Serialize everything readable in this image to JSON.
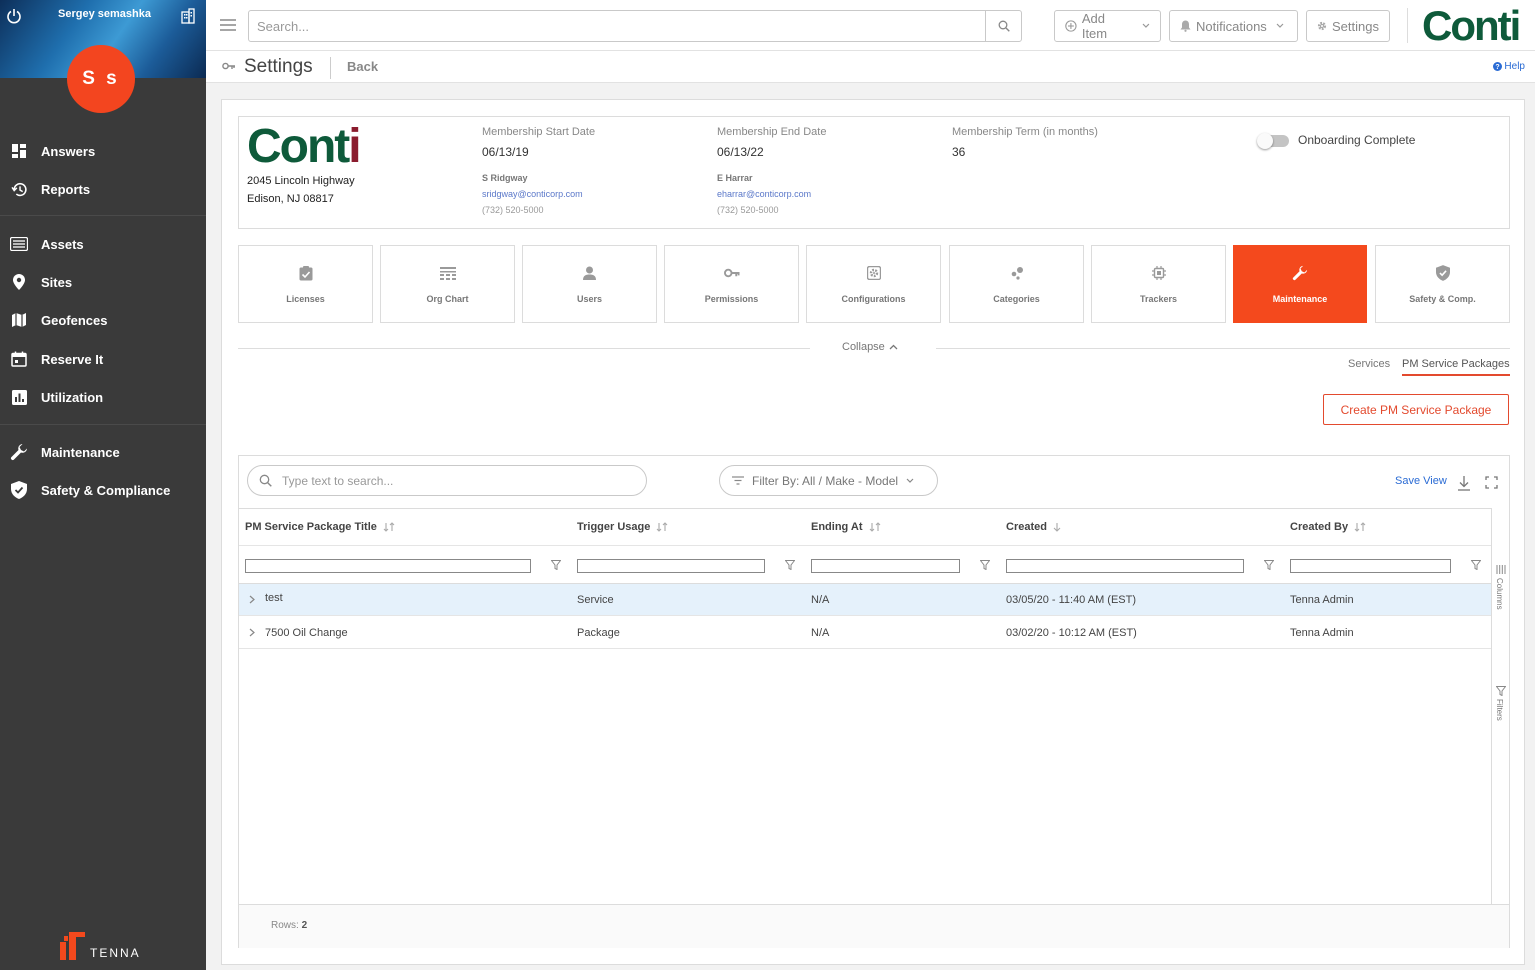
{
  "sidebar": {
    "user_name": "Sergey semashka",
    "avatar_initials": "S s",
    "items": [
      {
        "label": "Answers",
        "icon": "dashboard-icon"
      },
      {
        "label": "Reports",
        "icon": "history-icon"
      },
      {
        "label": "Assets",
        "icon": "list-icon"
      },
      {
        "label": "Sites",
        "icon": "map-pin-icon"
      },
      {
        "label": "Geofences",
        "icon": "map-icon"
      },
      {
        "label": "Reserve It",
        "icon": "calendar-icon"
      },
      {
        "label": "Utilization",
        "icon": "bar-chart-icon"
      },
      {
        "label": "Maintenance",
        "icon": "wrench-icon"
      },
      {
        "label": "Safety & Compliance",
        "icon": "shield-icon"
      }
    ],
    "brand": "TENNA"
  },
  "topbar": {
    "search_placeholder": "Search...",
    "add_item": "Add Item",
    "notifications": "Notifications",
    "settings": "Settings",
    "logo": "Conti"
  },
  "titlebar": {
    "title": "Settings",
    "back": "Back",
    "help": "Help"
  },
  "company": {
    "logo_main": "Cont",
    "logo_i": "i",
    "address_line1": "2045 Lincoln Highway",
    "address_line2": "Edison, NJ 08817",
    "start_label": "Membership Start Date",
    "start_value": "06/13/19",
    "start_contact_name": "S Ridgway",
    "start_contact_email": "sridgway@conticorp.com",
    "start_contact_phone": "(732) 520-5000",
    "end_label": "Membership End Date",
    "end_value": "06/13/22",
    "end_contact_name": "E Harrar",
    "end_contact_email": "eharrar@conticorp.com",
    "end_contact_phone": "(732) 520-5000",
    "term_label": "Membership Term (in months)",
    "term_value": "36",
    "onboarding_label": "Onboarding Complete",
    "onboarding_on": false
  },
  "tiles": [
    {
      "label": "Licenses",
      "icon": "license-icon"
    },
    {
      "label": "Org Chart",
      "icon": "org-chart-icon"
    },
    {
      "label": "Users",
      "icon": "user-icon"
    },
    {
      "label": "Permissions",
      "icon": "key-icon"
    },
    {
      "label": "Configurations",
      "icon": "config-icon"
    },
    {
      "label": "Categories",
      "icon": "categories-icon"
    },
    {
      "label": "Trackers",
      "icon": "tracker-icon"
    },
    {
      "label": "Maintenance",
      "icon": "wrench-icon",
      "active": true
    },
    {
      "label": "Safety & Comp.",
      "icon": "shield-icon"
    }
  ],
  "collapse_label": "Collapse",
  "subtabs": {
    "services": "Services",
    "pm_packages": "PM Service Packages"
  },
  "create_button": "Create PM Service Package",
  "grid": {
    "search_placeholder": "Type text to search...",
    "filter_label": "Filter By: All / Make - Model",
    "save_view": "Save View",
    "columns": [
      "PM Service Package Title",
      "Trigger Usage",
      "Ending At",
      "Created",
      "Created By"
    ],
    "rows": [
      {
        "title": "test",
        "trigger": "Service",
        "ending": "N/A",
        "created": "03/05/20 - 11:40 AM (EST)",
        "created_by": "Tenna Admin"
      },
      {
        "title": "7500 Oil Change",
        "trigger": "Package",
        "ending": "N/A",
        "created": "03/02/20 - 10:12 AM (EST)",
        "created_by": "Tenna Admin"
      }
    ],
    "side_columns": "Columns",
    "side_filters": "Filters",
    "rows_label": "Rows:",
    "rows_count": "2"
  },
  "colors": {
    "accent": "#f4491d",
    "brand_green": "#0e5a3a",
    "sidebar_bg": "#3a3a3a",
    "link_blue": "#2a6bd4",
    "selected_row": "#e5f1fb"
  }
}
